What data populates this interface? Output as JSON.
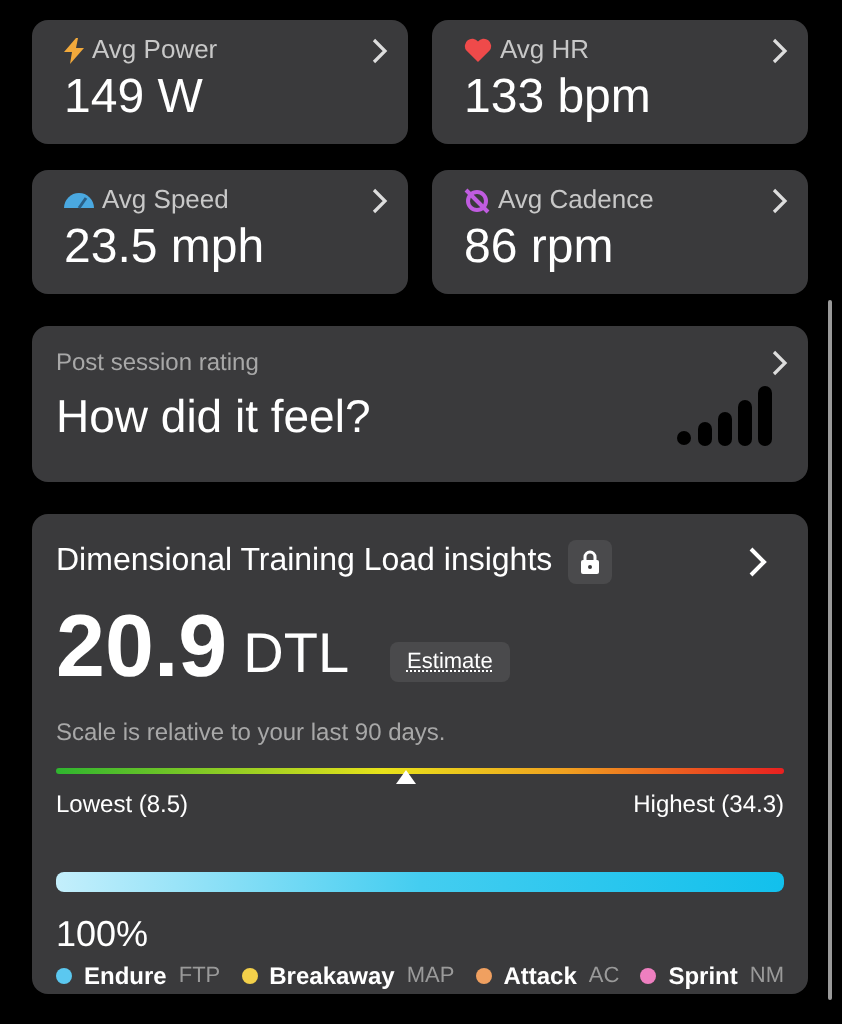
{
  "metrics": [
    {
      "kind": "power",
      "label": "Avg Power",
      "value": "149 W"
    },
    {
      "kind": "hr",
      "label": "Avg HR",
      "value": "133 bpm"
    },
    {
      "kind": "speed",
      "label": "Avg Speed",
      "value": "23.5 mph"
    },
    {
      "kind": "cadence",
      "label": "Avg Cadence",
      "value": "86 rpm"
    }
  ],
  "rating": {
    "label": "Post session rating",
    "prompt": "How did it feel?"
  },
  "dtl": {
    "title": "Dimensional Training Load insights",
    "locked": true,
    "value": "20.9",
    "unit": "DTL",
    "badge": "Estimate",
    "note": "Scale is relative to your last 90 days.",
    "scale": {
      "level": 0.48,
      "low": "Lowest (8.5)",
      "high": "Highest (34.3)"
    },
    "load": {
      "level": 1,
      "percent": "100%"
    },
    "legend": [
      {
        "name": "Endure",
        "code": "FTP",
        "color": "#5bc8f0"
      },
      {
        "name": "Breakaway",
        "code": "MAP",
        "color": "#f3d04a"
      },
      {
        "name": "Attack",
        "code": "AC",
        "color": "#f0a060"
      },
      {
        "name": "Sprint",
        "code": "NM",
        "color": "#ee7fc0"
      }
    ]
  }
}
